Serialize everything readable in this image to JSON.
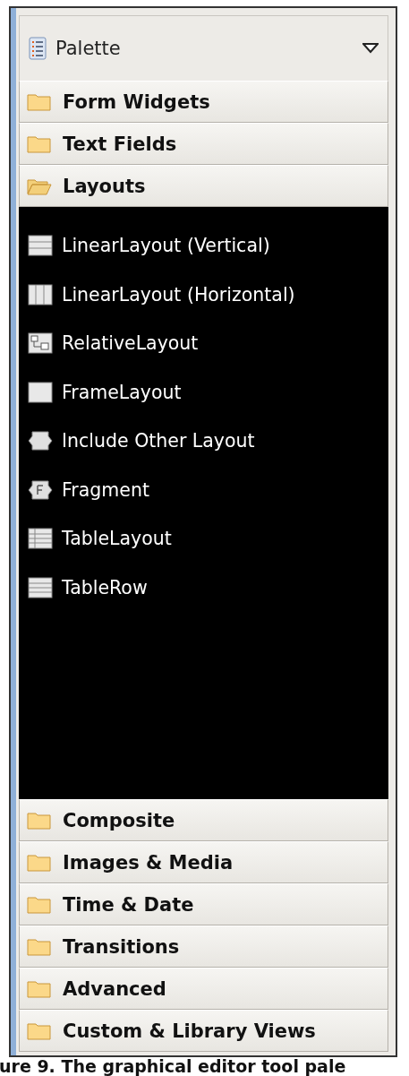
{
  "palette": {
    "title": "Palette",
    "drawers": [
      {
        "label": "Form Widgets",
        "expanded": false
      },
      {
        "label": "Text Fields",
        "expanded": false
      },
      {
        "label": "Layouts",
        "expanded": true,
        "items": [
          {
            "label": "LinearLayout (Vertical)",
            "kind": "rows"
          },
          {
            "label": "LinearLayout (Horizontal)",
            "kind": "columns"
          },
          {
            "label": "RelativeLayout",
            "kind": "relative"
          },
          {
            "label": "FrameLayout",
            "kind": "frame"
          },
          {
            "label": "Include Other Layout",
            "kind": "include"
          },
          {
            "label": "Fragment",
            "kind": "fragment"
          },
          {
            "label": "TableLayout",
            "kind": "table"
          },
          {
            "label": "TableRow",
            "kind": "tablerow"
          }
        ]
      },
      {
        "label": "Composite",
        "expanded": false
      },
      {
        "label": "Images & Media",
        "expanded": false
      },
      {
        "label": "Time & Date",
        "expanded": false
      },
      {
        "label": "Transitions",
        "expanded": false
      },
      {
        "label": "Advanced",
        "expanded": false
      },
      {
        "label": "Custom & Library Views",
        "expanded": false
      }
    ]
  },
  "caption": "ure 9. The graphical editor tool pale"
}
